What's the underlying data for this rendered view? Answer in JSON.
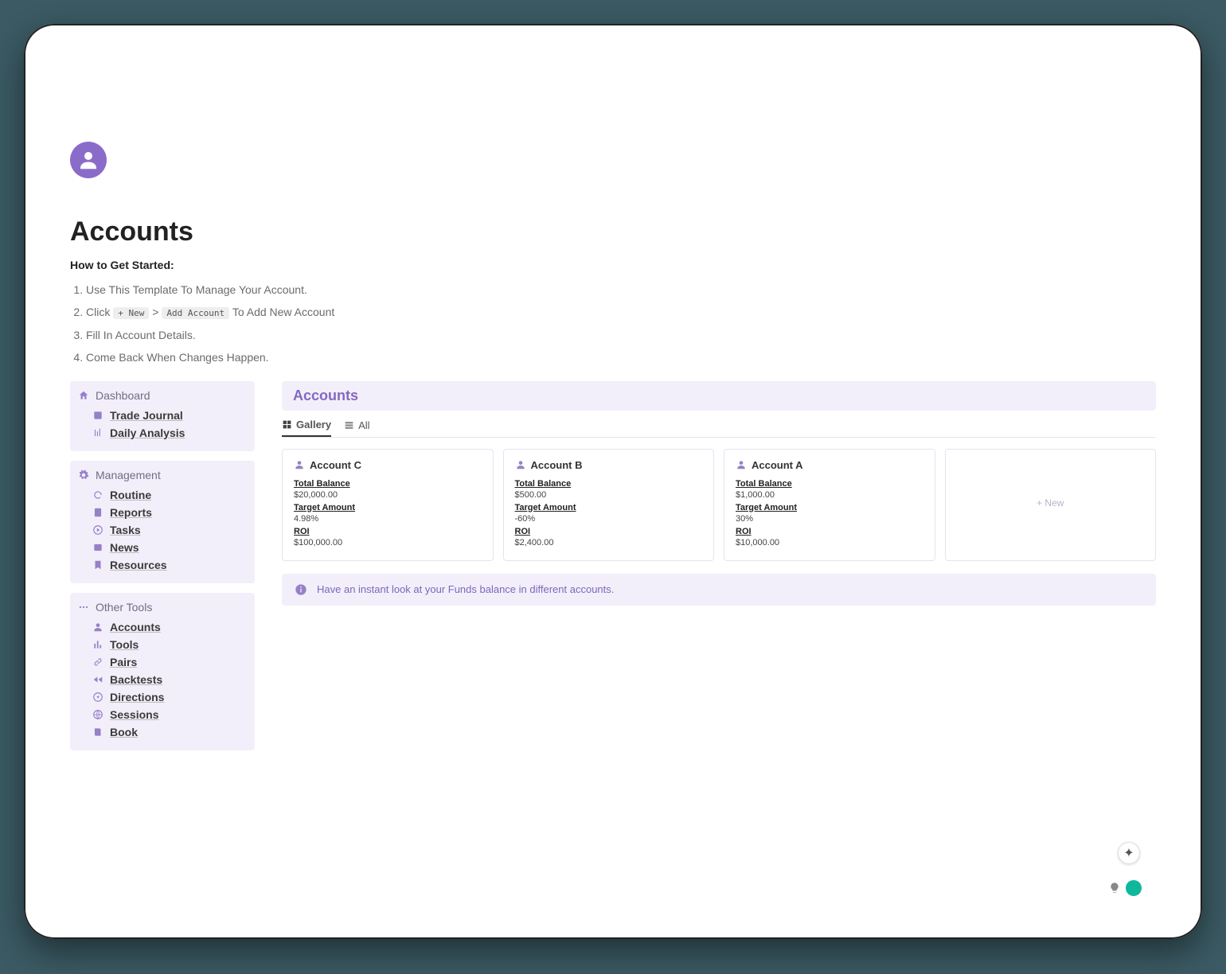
{
  "page": {
    "title": "Accounts",
    "subheading": "How to Get Started:",
    "steps": {
      "s1": "Use This Template To Manage Your Account.",
      "s2_prefix": "Click",
      "s2_pill1": "+ New",
      "s2_gt": ">",
      "s2_pill2": "Add Account",
      "s2_suffix": "To Add New Account",
      "s3": "Fill In Account Details.",
      "s4": "Come Back When Changes Happen."
    }
  },
  "sidebar": {
    "group1": {
      "title": "Dashboard",
      "items": [
        "Trade Journal",
        "Daily Analysis"
      ]
    },
    "group2": {
      "title": "Management",
      "items": [
        "Routine",
        "Reports",
        "Tasks",
        "News",
        "Resources"
      ]
    },
    "group3": {
      "title": "Other Tools",
      "items": [
        "Accounts",
        "Tools",
        "Pairs",
        "Backtests",
        "Directions",
        "Sessions",
        "Book"
      ]
    }
  },
  "main": {
    "panel_title": "Accounts",
    "tabs": {
      "gallery": "Gallery",
      "all": "All"
    },
    "field_labels": {
      "balance": "Total Balance",
      "target": "Target Amount",
      "roi": "ROI"
    },
    "cards": [
      {
        "name": "Account C",
        "balance": "$20,000.00",
        "target": "4.98%",
        "roi": "$100,000.00"
      },
      {
        "name": "Account B",
        "balance": "$500.00",
        "target": "-60%",
        "roi": "$2,400.00"
      },
      {
        "name": "Account A",
        "balance": "$1,000.00",
        "target": "30%",
        "roi": "$10,000.00"
      }
    ],
    "new_card_label": "+  New",
    "info": "Have an instant look at your Funds balance in different accounts."
  }
}
